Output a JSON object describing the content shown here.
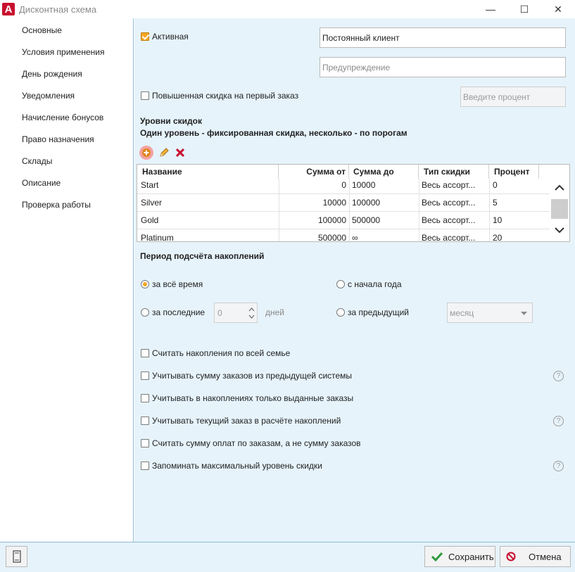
{
  "window": {
    "title": "Дисконтная схема",
    "logo_letter": "A",
    "minimize_glyph": "—",
    "maximize_glyph": "☐",
    "close_glyph": "✕"
  },
  "sidebar": {
    "items": [
      {
        "label": "Основные"
      },
      {
        "label": "Условия применения"
      },
      {
        "label": "День рождения"
      },
      {
        "label": "Уведомления"
      },
      {
        "label": "Начисление бонусов"
      },
      {
        "label": "Право назначения"
      },
      {
        "label": "Склады"
      },
      {
        "label": "Описание"
      },
      {
        "label": "Проверка работы"
      }
    ]
  },
  "main": {
    "active": {
      "label": "Активная",
      "checked": true
    },
    "name_value": "Постоянный клиент",
    "warning_placeholder": "Предупреждение",
    "first_order": {
      "label": "Повышенная скидка на первый заказ",
      "checked": false
    },
    "percent_placeholder": "Введите процент",
    "levels_title": "Уровни скидок",
    "levels_subtitle": "Один уровень - фиксированная скидка, несколько - по порогам",
    "toolbar": {
      "add": "add-icon",
      "edit": "pencil-icon",
      "delete": "delete-icon"
    },
    "table": {
      "columns": [
        "Название",
        "Сумма от",
        "Сумма до",
        "Тип скидки",
        "Процент"
      ],
      "rows": [
        [
          "Start",
          "0",
          "10000",
          "Весь ассорт...",
          "0"
        ],
        [
          "Silver",
          "10000",
          "100000",
          "Весь ассорт...",
          "5"
        ],
        [
          "Gold",
          "100000",
          "500000",
          "Весь ассорт...",
          "10"
        ],
        [
          "Platinum",
          "500000",
          "∞",
          "Весь ассорт...",
          "20"
        ]
      ]
    },
    "period": {
      "title": "Период подсчёта накоплений",
      "all_time": "за всё время",
      "year_start": "с начала года",
      "last": "за последние",
      "last_value": "0",
      "days": "дней",
      "previous": "за предыдущий",
      "previous_value": "месяц",
      "selected": "all_time"
    },
    "options": [
      {
        "label": "Считать накопления по всей семье",
        "checked": false,
        "help": false
      },
      {
        "label": "Учитывать сумму заказов из предыдущей системы",
        "checked": false,
        "help": true
      },
      {
        "label": "Учитывать в накоплениях только выданные заказы",
        "checked": false,
        "help": false
      },
      {
        "label": "Учитывать текущий заказ в расчёте накоплений",
        "checked": false,
        "help": true
      },
      {
        "label": "Считать сумму оплат по заказам, а не сумму заказов",
        "checked": false,
        "help": false
      },
      {
        "label": "Запоминать максимальный уровень скидки",
        "checked": false,
        "help": true
      }
    ],
    "help_glyph": "?"
  },
  "footer": {
    "save_label": "Сохранить",
    "cancel_label": "Отмена"
  },
  "colors": {
    "accent": "#f5a623",
    "panel_bg": "#e6f3fb",
    "delete_red": "#c8102e",
    "save_green": "#2e9b3c"
  }
}
